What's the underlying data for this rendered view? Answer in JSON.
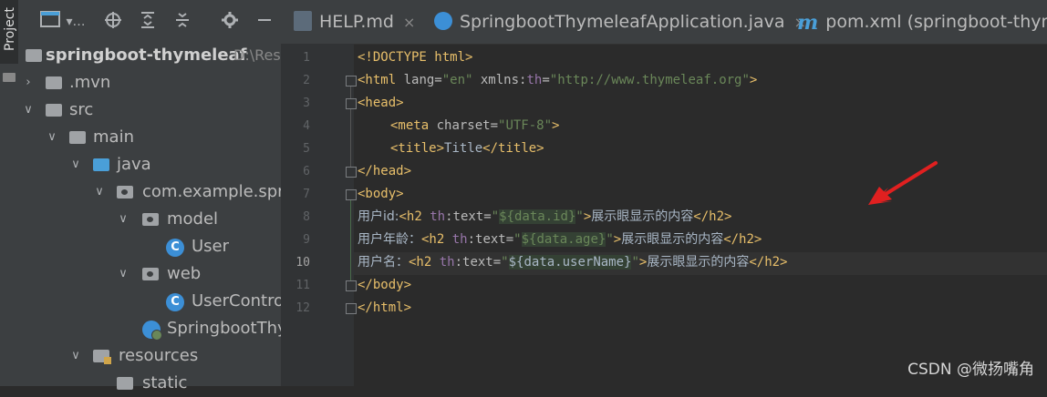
{
  "sidebar_strip": {
    "tab_label": "Project"
  },
  "project_panel": {
    "root": {
      "name": "springboot-thymeleaf",
      "path": "D:\\Res"
    },
    "items": [
      {
        "label": ".mvn"
      },
      {
        "label": "src"
      },
      {
        "label": "main"
      },
      {
        "label": "java"
      },
      {
        "label": "com.example.spri"
      },
      {
        "label": "model"
      },
      {
        "label": "User"
      },
      {
        "label": "web"
      },
      {
        "label": "UserContro"
      },
      {
        "label": "SpringbootThy"
      },
      {
        "label": "resources"
      },
      {
        "label": "static"
      }
    ]
  },
  "tabs": [
    {
      "label": "HELP.md",
      "close": "×"
    },
    {
      "label": "SpringbootThymeleafApplication.java",
      "close": "×"
    },
    {
      "label": "pom.xml (springboot-thyme"
    }
  ],
  "editor": {
    "line_numbers": [
      "1",
      "2",
      "3",
      "4",
      "5",
      "6",
      "7",
      "8",
      "9",
      "10",
      "11",
      "12"
    ],
    "current_line": "10",
    "lines": {
      "l1": "<!DOCTYPE html>",
      "l2_a": "<html",
      "l2_b": " lang=",
      "l2_c": "\"en\"",
      "l2_d": " xmlns:",
      "l2_e": "th",
      "l2_f": "=",
      "l2_g": "\"http://www.thymeleaf.org\"",
      "l2_h": ">",
      "l3": "<head>",
      "l4_a": "<meta",
      "l4_b": " charset=",
      "l4_c": "\"UTF-8\"",
      "l4_d": ">",
      "l5_a": "<title>",
      "l5_b": "Title",
      "l5_c": "</title>",
      "l6": "</head>",
      "l7": "<body>",
      "l8_pre": "用户id:",
      "l8_tag": "<h2",
      "l8_ns": " th",
      "l8_attr": ":text=",
      "l8_q1": "\"",
      "l8_expr": "${data.id}",
      "l8_q2": "\"",
      "l8_gt": ">",
      "l8_txt": "展示眼显示的内容",
      "l8_close": "</h2>",
      "l9_pre": "用户年龄：",
      "l9_tag": "<h2",
      "l9_ns": " th",
      "l9_attr": ":text=",
      "l9_q1": "\"",
      "l9_expr": "${data.age}",
      "l9_q2": "\"",
      "l9_gt": ">",
      "l9_txt": "展示眼显示的内容",
      "l9_close": "</h2>",
      "l10_pre": "用户名：",
      "l10_tag": "<h2",
      "l10_ns": " th",
      "l10_attr": ":text=",
      "l10_q1": "\"",
      "l10_expr": "${data.userName}",
      "l10_q2": "\"",
      "l10_gt": ">",
      "l10_txt": "展示眼显示的内容",
      "l10_close": "</h2>",
      "l11": "</body>",
      "l12": "</html>"
    }
  },
  "watermark": "CSDN @微扬嘴角",
  "colors": {
    "arrow": "#e02020",
    "tag": "#e8bf6a",
    "string": "#6a8759",
    "namespace": "#9876aa"
  }
}
